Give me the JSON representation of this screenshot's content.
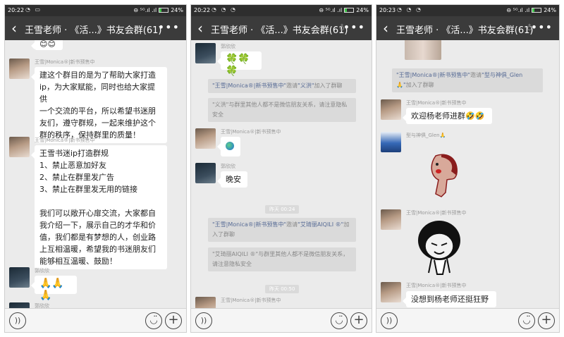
{
  "screens": [
    {
      "status": {
        "time": "20:22",
        "battery": "24%",
        "battery_level": 0.24
      },
      "title": "王雪老师 · 《活...》书友会群(61)",
      "messages": [
        {
          "sender": "王雪|Monica®|新书预售中",
          "text_lines": [
            "建这个群目的是为了帮助大家打造",
            "ip，为大家赋能，同时也给大家提供",
            "一个交流的平台，所以希望书迷朋",
            "友们，遵守群规，一起来维护这个",
            "群的秩序，保持群里的质量！"
          ]
        },
        {
          "sender": "王雪|Monica®|新书预售中",
          "text_lines": [
            "王雪书迷ip打造群规",
            "1、禁止恶意加好友",
            "2、禁止在群里发广告",
            "3、禁止在群里发无用的链接",
            "",
            "我们可以敞开心扉交流，大家都自",
            "我介绍一下，展示自己的才华和价",
            "值，我们都是有梦想的人，创业路",
            "上互相温暖，希望我的书迷朋友们",
            "能够相互温暖、鼓励！"
          ]
        },
        {
          "sender": "郭欣欣",
          "text": "🙏🙏🙏"
        },
        {
          "sender": "郭欣欣",
          "text": ""
        }
      ],
      "top_emoji": "😊😊"
    },
    {
      "status": {
        "time": "20:22",
        "battery": "24%",
        "battery_level": 0.24
      },
      "title": "王雪老师 · 《活...》书友会群(61)",
      "messages": [
        {
          "sender": "郭欣欣",
          "text": "🍀🍀🍀"
        },
        {
          "sender": "王雪|Monica®|新书预售中",
          "text": ""
        },
        {
          "sender": "郭欣欣",
          "text": "晚安"
        }
      ],
      "sys1": {
        "a": "\"王雪|Monica®|新书预售中\"",
        "mid": "邀请",
        "b": "\"义洪\"",
        "end": "加入了群聊"
      },
      "sys2": "\"义洪\"与群里其他人都不是微信朋友关系，请注意隐私安全",
      "time1": "昨天 00:24",
      "sys3": {
        "a": "\"王雪|Monica®|新书预售中\"",
        "mid": "邀请",
        "b": "\"艾琦丽AIQILI ®\"",
        "end": "加入了群聊"
      },
      "sys4": {
        "b": "\"艾琦丽AIQILI ®\"",
        "end": "与群里其他人都不是微信朋友关系，请注意隐私安全"
      },
      "time2": "昨天 00:50",
      "last_sender": "王雪|Monica®|新书预售中"
    },
    {
      "status": {
        "time": "20:23",
        "battery": "24%",
        "battery_level": 0.24
      },
      "title": "王雪老师 · 《活...》书友会群(61)",
      "sys1": {
        "a": "\"王雪|Monica®|新书预售中\"",
        "mid": "邀请",
        "b": "\"型与神俱_Glen 🙏\"",
        "end": "加入了群聊"
      },
      "messages": [
        {
          "sender": "王雪|Monica®|新书预售中",
          "text": "欢迎杨老师进群🤣🤣"
        },
        {
          "sender": "型与神俱_Glen🙏",
          "text": ""
        },
        {
          "sender": "王雪|Monica®|新书预售中",
          "text": ""
        },
        {
          "sender": "王雪|Monica®|新书预售中",
          "text": "没想到杨老师还挺狂野"
        }
      ]
    }
  ]
}
